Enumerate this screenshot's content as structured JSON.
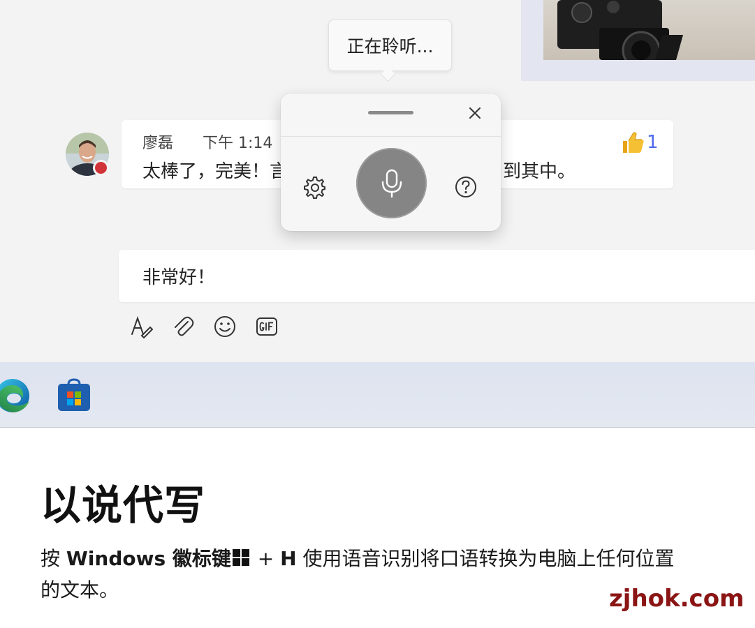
{
  "tooltip": {
    "text": "正在聆听..."
  },
  "message": {
    "sender": "廖磊",
    "time": "下午 1:14",
    "text_left": "太棒了，完美！言",
    "text_right": "到其中。",
    "reaction_emoji": "👍",
    "reaction_count": "1"
  },
  "voice_panel": {
    "drag_handle": "drag-handle",
    "close_icon": "close-icon",
    "settings_icon": "gear-icon",
    "mic_icon": "microphone-icon",
    "help_icon": "question-circle-icon"
  },
  "compose": {
    "text": "非常好！",
    "tools": [
      "format-text-icon",
      "attach-icon",
      "emoji-icon",
      "gif-icon"
    ]
  },
  "taskbar": {
    "apps": [
      "edge-icon",
      "microsoft-store-icon"
    ]
  },
  "promo": {
    "heading": "以说代写",
    "desc_prefix": "按 ",
    "desc_key1": "Windows 徽标键",
    "desc_plus": " + ",
    "desc_key2": "H",
    "desc_suffix_line1": " 使用语音识别将口语转换为电脑上任何位置",
    "desc_suffix_line2": "的文本。"
  },
  "watermark": "zjhok.com",
  "colors": {
    "presence_busy": "#d13438",
    "mic_button": "#858585",
    "reaction_count": "#4f6bed",
    "watermark": "#8b1414"
  }
}
